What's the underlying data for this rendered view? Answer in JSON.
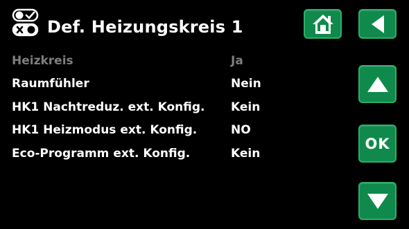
{
  "header": {
    "title": "Def. Heizungskreis 1",
    "icon": "settings-toggle-icon"
  },
  "buttons": {
    "home_icon": "home-icon",
    "back_icon": "back-arrow-icon",
    "up_icon": "arrow-up-icon",
    "ok_label": "OK",
    "down_icon": "arrow-down-icon"
  },
  "settings": [
    {
      "label": "Heizkreis",
      "value": "Ja",
      "disabled": true
    },
    {
      "label": "Raumfühler",
      "value": "Nein",
      "disabled": false
    },
    {
      "label": "HK1 Nachtreduz. ext. Konfig.",
      "value": "Kein",
      "disabled": false
    },
    {
      "label": "HK1 Heizmodus ext. Konfig.",
      "value": "NO",
      "disabled": false
    },
    {
      "label": "Eco-Programm ext. Konfig.",
      "value": "Kein",
      "disabled": false
    }
  ],
  "colors": {
    "background": "#000000",
    "text": "#ffffff",
    "disabled_text": "#7e7e7e",
    "button_fill": "#0f8a4c",
    "button_border": "#2dae6a"
  }
}
